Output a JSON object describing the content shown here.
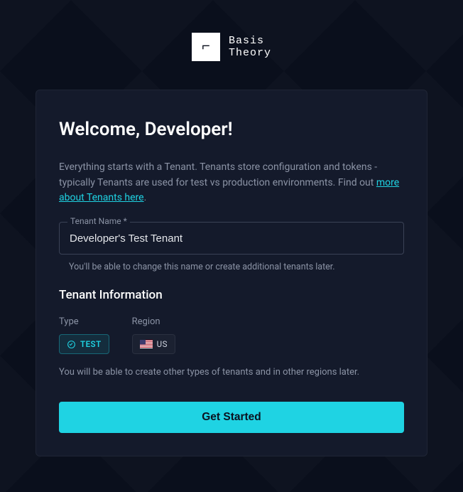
{
  "brand": {
    "mark_glyph": "⌐",
    "name_line1": "Basis",
    "name_line2": "Theory"
  },
  "card": {
    "title": "Welcome, Developer!",
    "intro_prefix": "Everything starts with a Tenant. Tenants store configuration and tokens - typically Tenants are used for test vs production environments. Find out ",
    "intro_link": "more about Tenants here",
    "intro_suffix": ".",
    "tenant_name": {
      "label": "Tenant Name *",
      "value": "Developer's Test Tenant",
      "hint": "You'll be able to change this name or create additional tenants later."
    },
    "tenant_info": {
      "heading": "Tenant Information",
      "type_label": "Type",
      "type_value": "TEST",
      "region_label": "Region",
      "region_value": "US",
      "note": "You will be able to create other types of tenants and in other regions later."
    },
    "cta_label": "Get Started"
  },
  "colors": {
    "accent": "#1fd3e3",
    "card_bg": "#141a2b",
    "page_bg": "#0a0f1c"
  }
}
